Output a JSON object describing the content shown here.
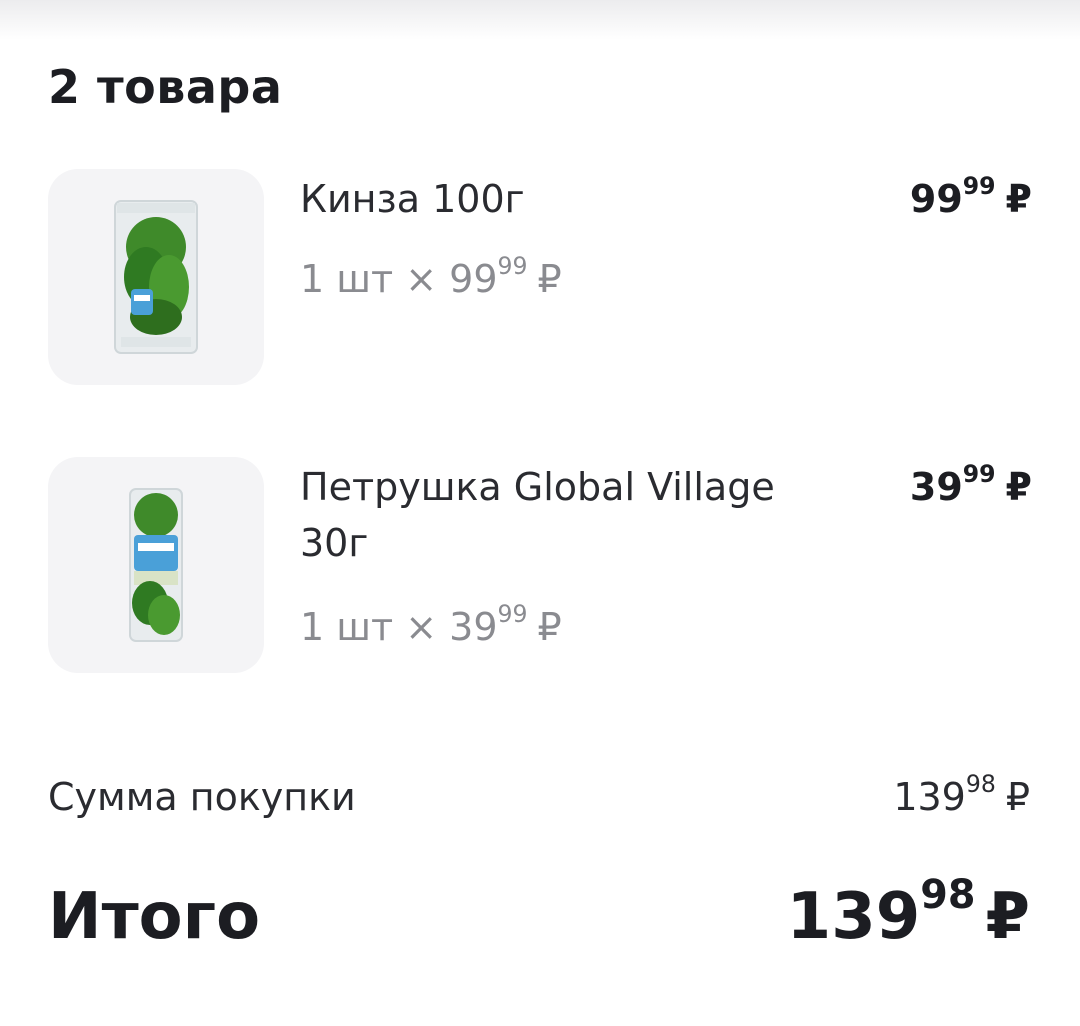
{
  "header": {
    "count_title": "2 товара"
  },
  "items": [
    {
      "name": "Кинза 100г",
      "qty_prefix": "1 шт × ",
      "unit_price_int": "99",
      "unit_price_dec": "99",
      "price_int": "99",
      "price_dec": "99",
      "currency": "₽"
    },
    {
      "name": "Петрушка Global Village 30г",
      "qty_prefix": "1 шт × ",
      "unit_price_int": "39",
      "unit_price_dec": "99",
      "price_int": "39",
      "price_dec": "99",
      "currency": "₽"
    }
  ],
  "summary": {
    "sum_label": "Сумма покупки",
    "sum_int": "139",
    "sum_dec": "98",
    "total_label": "Итого",
    "total_int": "139",
    "total_dec": "98",
    "currency": "₽"
  },
  "icons": {
    "product_1": "cilantro-pack-icon",
    "product_2": "parsley-pack-icon"
  }
}
